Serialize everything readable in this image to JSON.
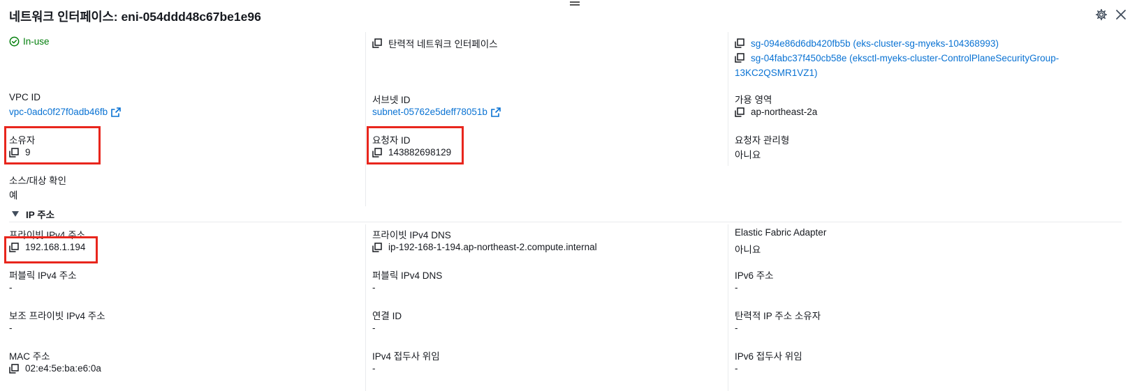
{
  "header": {
    "title": "네트워크 인터페이스: eni-054ddd48c67be1e96"
  },
  "summary": {
    "status": "In-use",
    "interface_type": "탄력적 네트워크 인터페이스",
    "security_groups": [
      "sg-094e86d6db420fb5b (eks-cluster-sg-myeks-104368993)",
      "sg-04fabc37f450cb58e (eksctl-myeks-cluster-ControlPlaneSecurityGroup-13KC2QSMR1VZ1)"
    ]
  },
  "fields": {
    "vpc_id": {
      "label": "VPC ID",
      "value": "vpc-0adc0f27f0adb46fb"
    },
    "subnet_id": {
      "label": "서브넷 ID",
      "value": "subnet-05762e5deff78051b"
    },
    "az": {
      "label": "가용 영역",
      "value": "ap-northeast-2a"
    },
    "owner": {
      "label": "소유자",
      "value": "9"
    },
    "requester_id": {
      "label": "요청자 ID",
      "value": "143882698129"
    },
    "requester_managed": {
      "label": "요청자 관리형",
      "value": "아니요"
    },
    "source_dest_check": {
      "label": "소스/대상 확인",
      "value": "예"
    }
  },
  "ip_section": {
    "title": "IP 주소",
    "private_ipv4": {
      "label": "프라이빗 IPv4 주소",
      "value": "192.168.1.194"
    },
    "private_dns": {
      "label": "프라이빗 IPv4 DNS",
      "value": "ip-192-168-1-194.ap-northeast-2.compute.internal"
    },
    "efa": {
      "label": "Elastic Fabric Adapter",
      "value": "아니요"
    },
    "public_ipv4": {
      "label": "퍼블릭 IPv4 주소",
      "value": "-"
    },
    "public_dns": {
      "label": "퍼블릭 IPv4 DNS",
      "value": "-"
    },
    "ipv6": {
      "label": "IPv6 주소",
      "value": "-"
    },
    "secondary_ipv4": {
      "label": "보조 프라이빗 IPv4 주소",
      "value": "-"
    },
    "association_id": {
      "label": "연결 ID",
      "value": "-"
    },
    "eip_owner": {
      "label": "탄력적 IP 주소 소유자",
      "value": "-"
    },
    "mac": {
      "label": "MAC 주소",
      "value": "02:e4:5e:ba:e6:0a"
    },
    "ipv4_prefix": {
      "label": "IPv4 접두사 위임",
      "value": "-"
    },
    "ipv6_prefix": {
      "label": "IPv6 접두사 위임",
      "value": "-"
    }
  },
  "colors": {
    "link": "#0972d3",
    "success": "#037f0c",
    "highlight": "#e8261d"
  },
  "icons": [
    "drag-handle-icon",
    "settings-icon",
    "close-icon",
    "copy-icon",
    "external-link-icon",
    "status-ok-icon",
    "caret-down-icon"
  ]
}
